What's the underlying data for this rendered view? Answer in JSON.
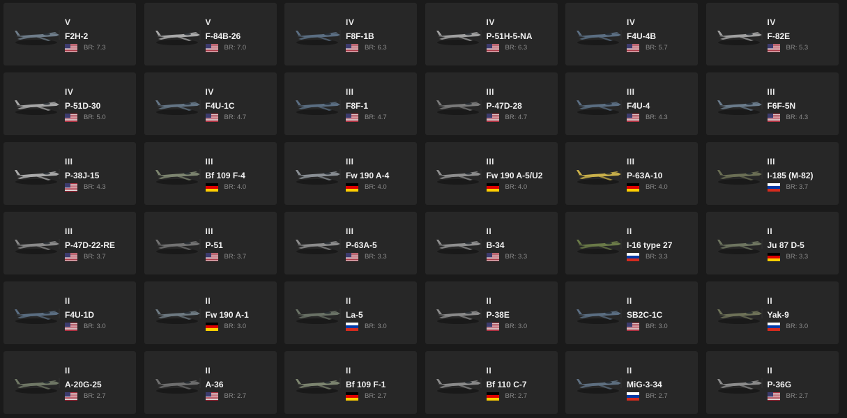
{
  "flags": {
    "usa": {
      "country": "USA",
      "colors": [
        "#b22234",
        "#ffffff",
        "#3c3b6e"
      ]
    },
    "germany": {
      "country": "Germany",
      "colors": [
        "#000000",
        "#dd0000",
        "#ffce00"
      ]
    },
    "ussr": {
      "country": "USSR",
      "colors": [
        "#ffffff",
        "#0039a6",
        "#d52b1e"
      ]
    }
  },
  "vehicles": [
    {
      "rank": "V",
      "name": "F2H-2",
      "flag": "usa",
      "br": "BR: 7.3",
      "color": "#6f7d8a",
      "icon": "aircraft-icon"
    },
    {
      "rank": "V",
      "name": "F-84B-26",
      "flag": "usa",
      "br": "BR: 7.0",
      "color": "#a9a9a9",
      "icon": "aircraft-icon"
    },
    {
      "rank": "IV",
      "name": "F8F-1B",
      "flag": "usa",
      "br": "BR: 6.3",
      "color": "#5b6e82",
      "icon": "aircraft-icon"
    },
    {
      "rank": "IV",
      "name": "P-51H-5-NA",
      "flag": "usa",
      "br": "BR: 6.3",
      "color": "#a0a0a0",
      "icon": "aircraft-icon"
    },
    {
      "rank": "IV",
      "name": "F4U-4B",
      "flag": "usa",
      "br": "BR: 5.7",
      "color": "#5b6e82",
      "icon": "aircraft-icon"
    },
    {
      "rank": "IV",
      "name": "F-82E",
      "flag": "usa",
      "br": "BR: 5.3",
      "color": "#a0a0a0",
      "icon": "aircraft-icon"
    },
    {
      "rank": "IV",
      "name": "P-51D-30",
      "flag": "usa",
      "br": "BR: 5.0",
      "color": "#a7a7a7",
      "icon": "aircraft-icon"
    },
    {
      "rank": "IV",
      "name": "F4U-1C",
      "flag": "usa",
      "br": "BR: 4.7",
      "color": "#647585",
      "icon": "aircraft-icon"
    },
    {
      "rank": "III",
      "name": "F8F-1",
      "flag": "usa",
      "br": "BR: 4.7",
      "color": "#5b6e82",
      "icon": "aircraft-icon"
    },
    {
      "rank": "III",
      "name": "P-47D-28",
      "flag": "usa",
      "br": "BR: 4.7",
      "color": "#7a7a7a",
      "icon": "aircraft-icon"
    },
    {
      "rank": "III",
      "name": "F4U-4",
      "flag": "usa",
      "br": "BR: 4.3",
      "color": "#5b6e82",
      "icon": "aircraft-icon"
    },
    {
      "rank": "III",
      "name": "F6F-5N",
      "flag": "usa",
      "br": "BR: 4.3",
      "color": "#6b7c8c",
      "icon": "aircraft-icon"
    },
    {
      "rank": "III",
      "name": "P-38J-15",
      "flag": "usa",
      "br": "BR: 4.3",
      "color": "#aaaaaa",
      "icon": "aircraft-icon"
    },
    {
      "rank": "III",
      "name": "Bf 109 F-4",
      "flag": "germany",
      "br": "BR: 4.0",
      "color": "#7d8570",
      "icon": "aircraft-icon"
    },
    {
      "rank": "III",
      "name": "Fw 190 A-4",
      "flag": "germany",
      "br": "BR: 4.0",
      "color": "#8a8f94",
      "icon": "aircraft-icon"
    },
    {
      "rank": "III",
      "name": "Fw 190 A-5/U2",
      "flag": "germany",
      "br": "BR: 4.0",
      "color": "#8e8e8e",
      "icon": "aircraft-icon"
    },
    {
      "rank": "III",
      "name": "P-63A-10",
      "flag": "germany",
      "br": "BR: 4.0",
      "color": "#c9b04a",
      "icon": "aircraft-icon"
    },
    {
      "rank": "III",
      "name": "I-185 (M-82)",
      "flag": "ussr",
      "br": "BR: 3.7",
      "color": "#6b6f55",
      "icon": "aircraft-icon"
    },
    {
      "rank": "III",
      "name": "P-47D-22-RE",
      "flag": "usa",
      "br": "BR: 3.7",
      "color": "#8a8a8a",
      "icon": "aircraft-icon"
    },
    {
      "rank": "III",
      "name": "P-51",
      "flag": "usa",
      "br": "BR: 3.7",
      "color": "#727272",
      "icon": "aircraft-icon"
    },
    {
      "rank": "III",
      "name": "P-63A-5",
      "flag": "usa",
      "br": "BR: 3.3",
      "color": "#8c8c8c",
      "icon": "aircraft-icon"
    },
    {
      "rank": "II",
      "name": "B-34",
      "flag": "usa",
      "br": "BR: 3.3",
      "color": "#8f8f8f",
      "icon": "aircraft-icon"
    },
    {
      "rank": "II",
      "name": "I-16 type 27",
      "flag": "ussr",
      "br": "BR: 3.3",
      "color": "#6a7a48",
      "icon": "aircraft-icon"
    },
    {
      "rank": "II",
      "name": "Ju 87 D-5",
      "flag": "germany",
      "br": "BR: 3.3",
      "color": "#6e7560",
      "icon": "aircraft-icon"
    },
    {
      "rank": "II",
      "name": "F4U-1D",
      "flag": "usa",
      "br": "BR: 3.0",
      "color": "#5b6e82",
      "icon": "aircraft-icon"
    },
    {
      "rank": "II",
      "name": "Fw 190 A-1",
      "flag": "germany",
      "br": "BR: 3.0",
      "color": "#6e7a82",
      "icon": "aircraft-icon"
    },
    {
      "rank": "II",
      "name": "La-5",
      "flag": "ussr",
      "br": "BR: 3.0",
      "color": "#6a7266",
      "icon": "aircraft-icon"
    },
    {
      "rank": "II",
      "name": "P-38E",
      "flag": "usa",
      "br": "BR: 3.0",
      "color": "#8a8a8a",
      "icon": "aircraft-icon"
    },
    {
      "rank": "II",
      "name": "SB2C-1C",
      "flag": "usa",
      "br": "BR: 3.0",
      "color": "#5b6e82",
      "icon": "aircraft-icon"
    },
    {
      "rank": "II",
      "name": "Yak-9",
      "flag": "ussr",
      "br": "BR: 3.0",
      "color": "#6e7258",
      "icon": "aircraft-icon"
    },
    {
      "rank": "II",
      "name": "A-20G-25",
      "flag": "usa",
      "br": "BR: 2.7",
      "color": "#707866",
      "icon": "aircraft-icon"
    },
    {
      "rank": "II",
      "name": "A-36",
      "flag": "usa",
      "br": "BR: 2.7",
      "color": "#6e6e6e",
      "icon": "aircraft-icon"
    },
    {
      "rank": "II",
      "name": "Bf 109 F-1",
      "flag": "germany",
      "br": "BR: 2.7",
      "color": "#7d8570",
      "icon": "aircraft-icon"
    },
    {
      "rank": "II",
      "name": "Bf 110 C-7",
      "flag": "germany",
      "br": "BR: 2.7",
      "color": "#8a8a8a",
      "icon": "aircraft-icon"
    },
    {
      "rank": "II",
      "name": "MiG-3-34",
      "flag": "ussr",
      "br": "BR: 2.7",
      "color": "#5e6f80",
      "icon": "aircraft-icon"
    },
    {
      "rank": "II",
      "name": "P-36G",
      "flag": "usa",
      "br": "BR: 2.7",
      "color": "#8c8c8c",
      "icon": "aircraft-icon"
    }
  ]
}
